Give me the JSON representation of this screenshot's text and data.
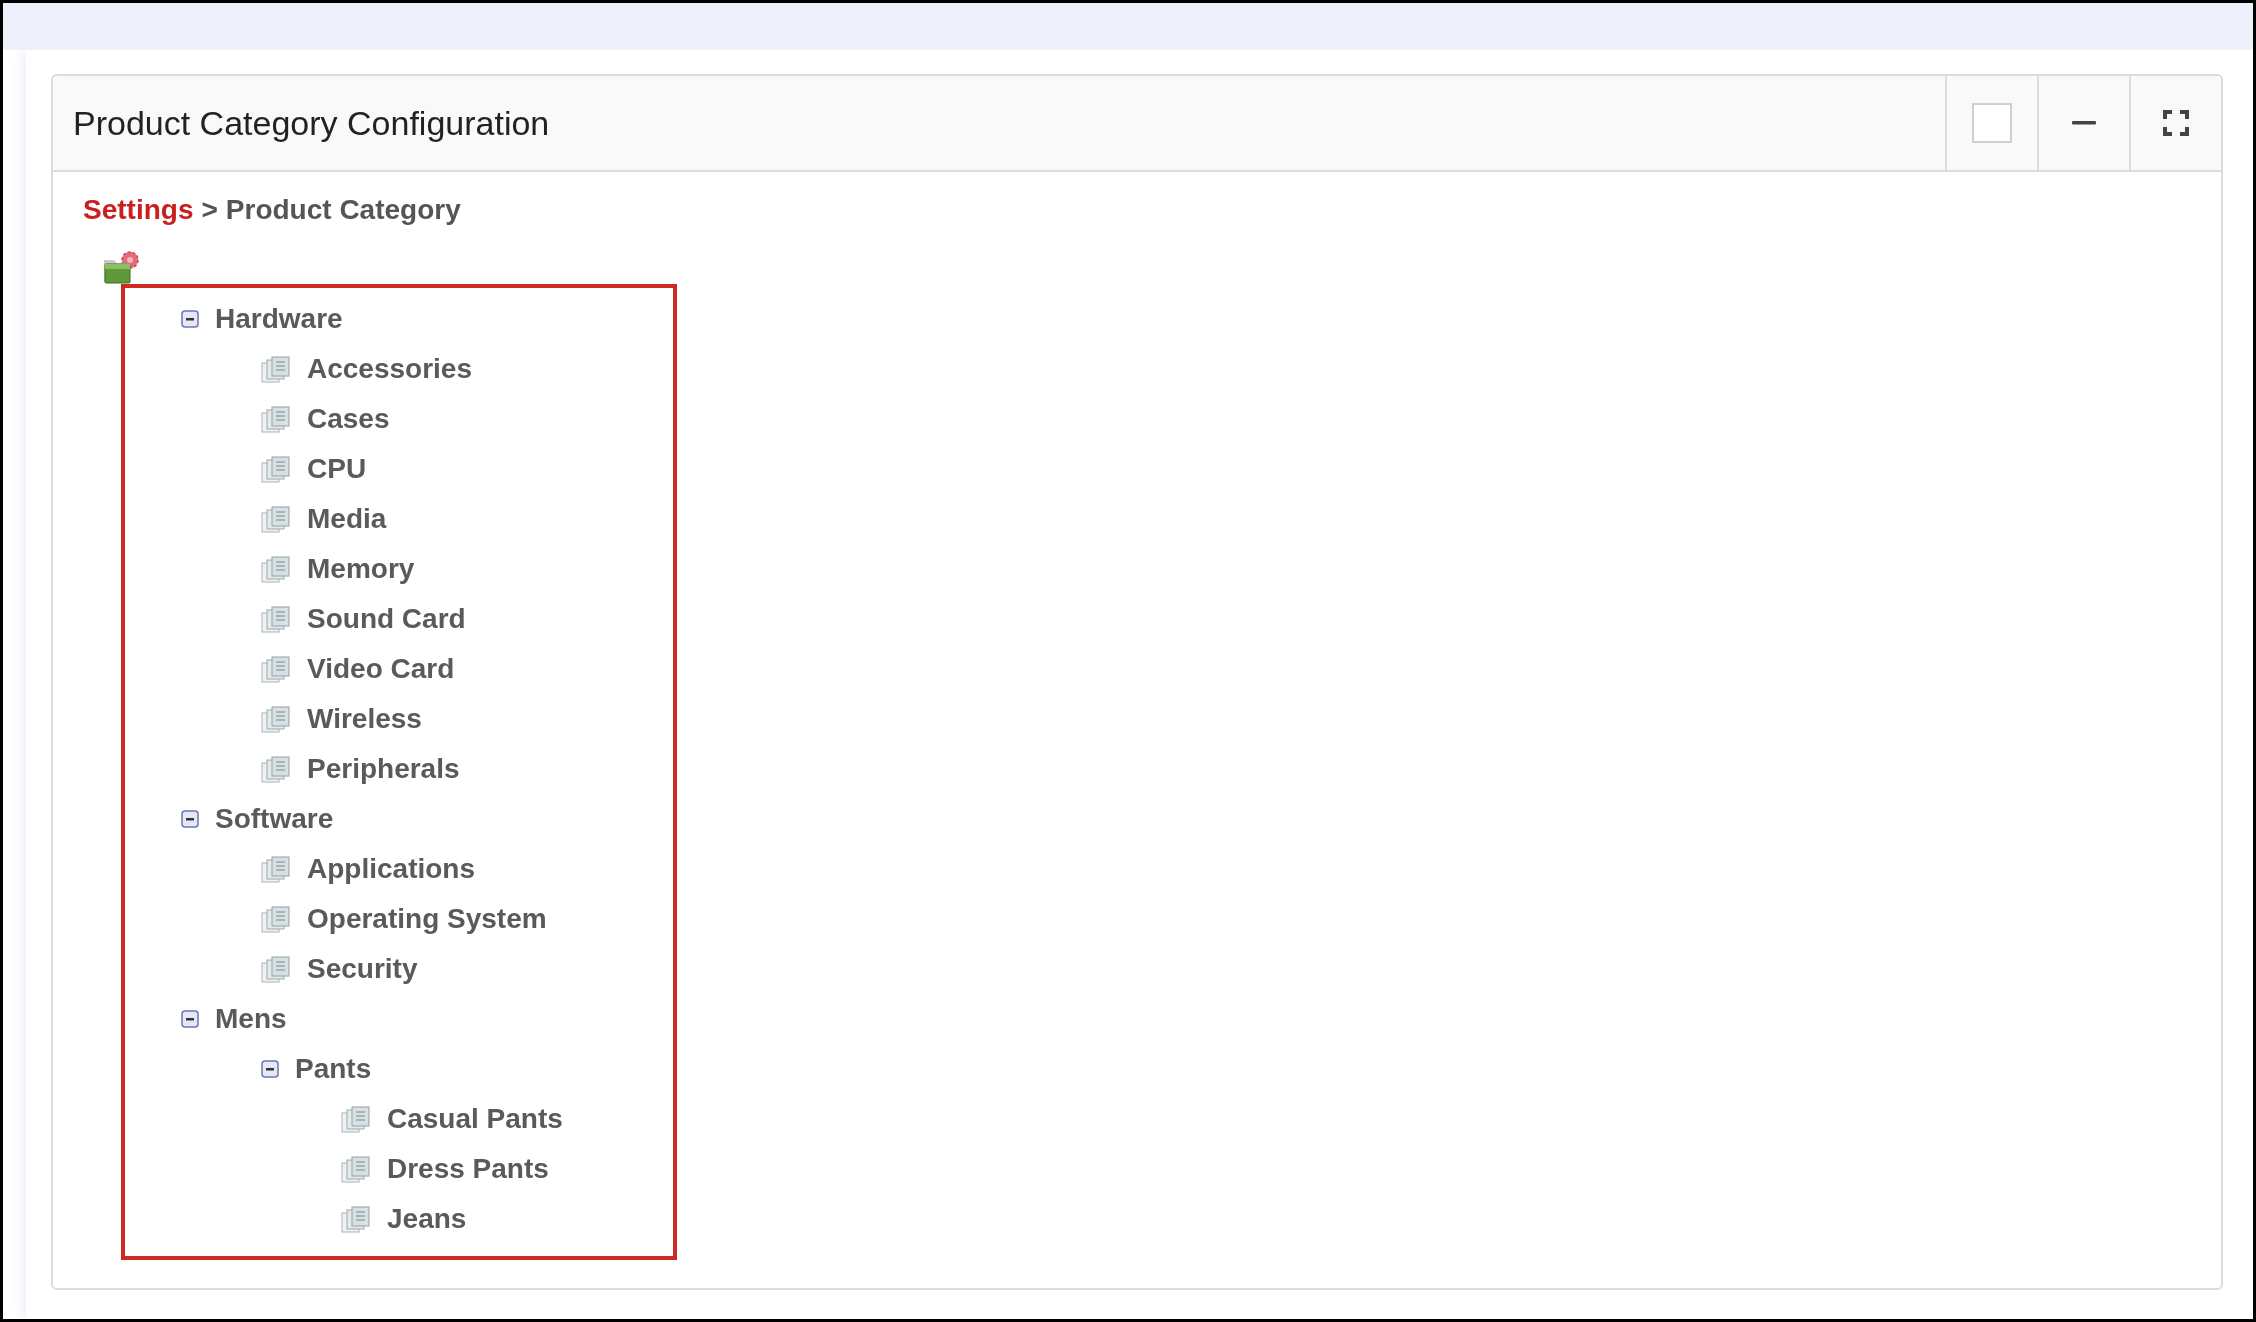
{
  "panel": {
    "title": "Product Category Configuration"
  },
  "breadcrumb": {
    "link": "Settings",
    "separator": ">",
    "current": "Product Category"
  },
  "tree": [
    {
      "label": "Hardware",
      "kind": "folder",
      "expanded": true,
      "children": [
        {
          "label": "Accessories",
          "kind": "leaf"
        },
        {
          "label": "Cases",
          "kind": "leaf"
        },
        {
          "label": "CPU",
          "kind": "leaf"
        },
        {
          "label": "Media",
          "kind": "leaf"
        },
        {
          "label": "Memory",
          "kind": "leaf"
        },
        {
          "label": "Sound Card",
          "kind": "leaf"
        },
        {
          "label": "Video Card",
          "kind": "leaf"
        },
        {
          "label": "Wireless",
          "kind": "leaf"
        },
        {
          "label": "Peripherals",
          "kind": "leaf"
        }
      ]
    },
    {
      "label": "Software",
      "kind": "folder",
      "expanded": true,
      "children": [
        {
          "label": "Applications",
          "kind": "leaf"
        },
        {
          "label": "Operating System",
          "kind": "leaf"
        },
        {
          "label": "Security",
          "kind": "leaf"
        }
      ]
    },
    {
      "label": "Mens",
      "kind": "folder",
      "expanded": true,
      "children": [
        {
          "label": "Pants",
          "kind": "folder",
          "expanded": true,
          "children": [
            {
              "label": "Casual Pants",
              "kind": "leaf"
            },
            {
              "label": "Dress Pants",
              "kind": "leaf"
            },
            {
              "label": "Jeans",
              "kind": "leaf"
            }
          ]
        }
      ]
    }
  ]
}
